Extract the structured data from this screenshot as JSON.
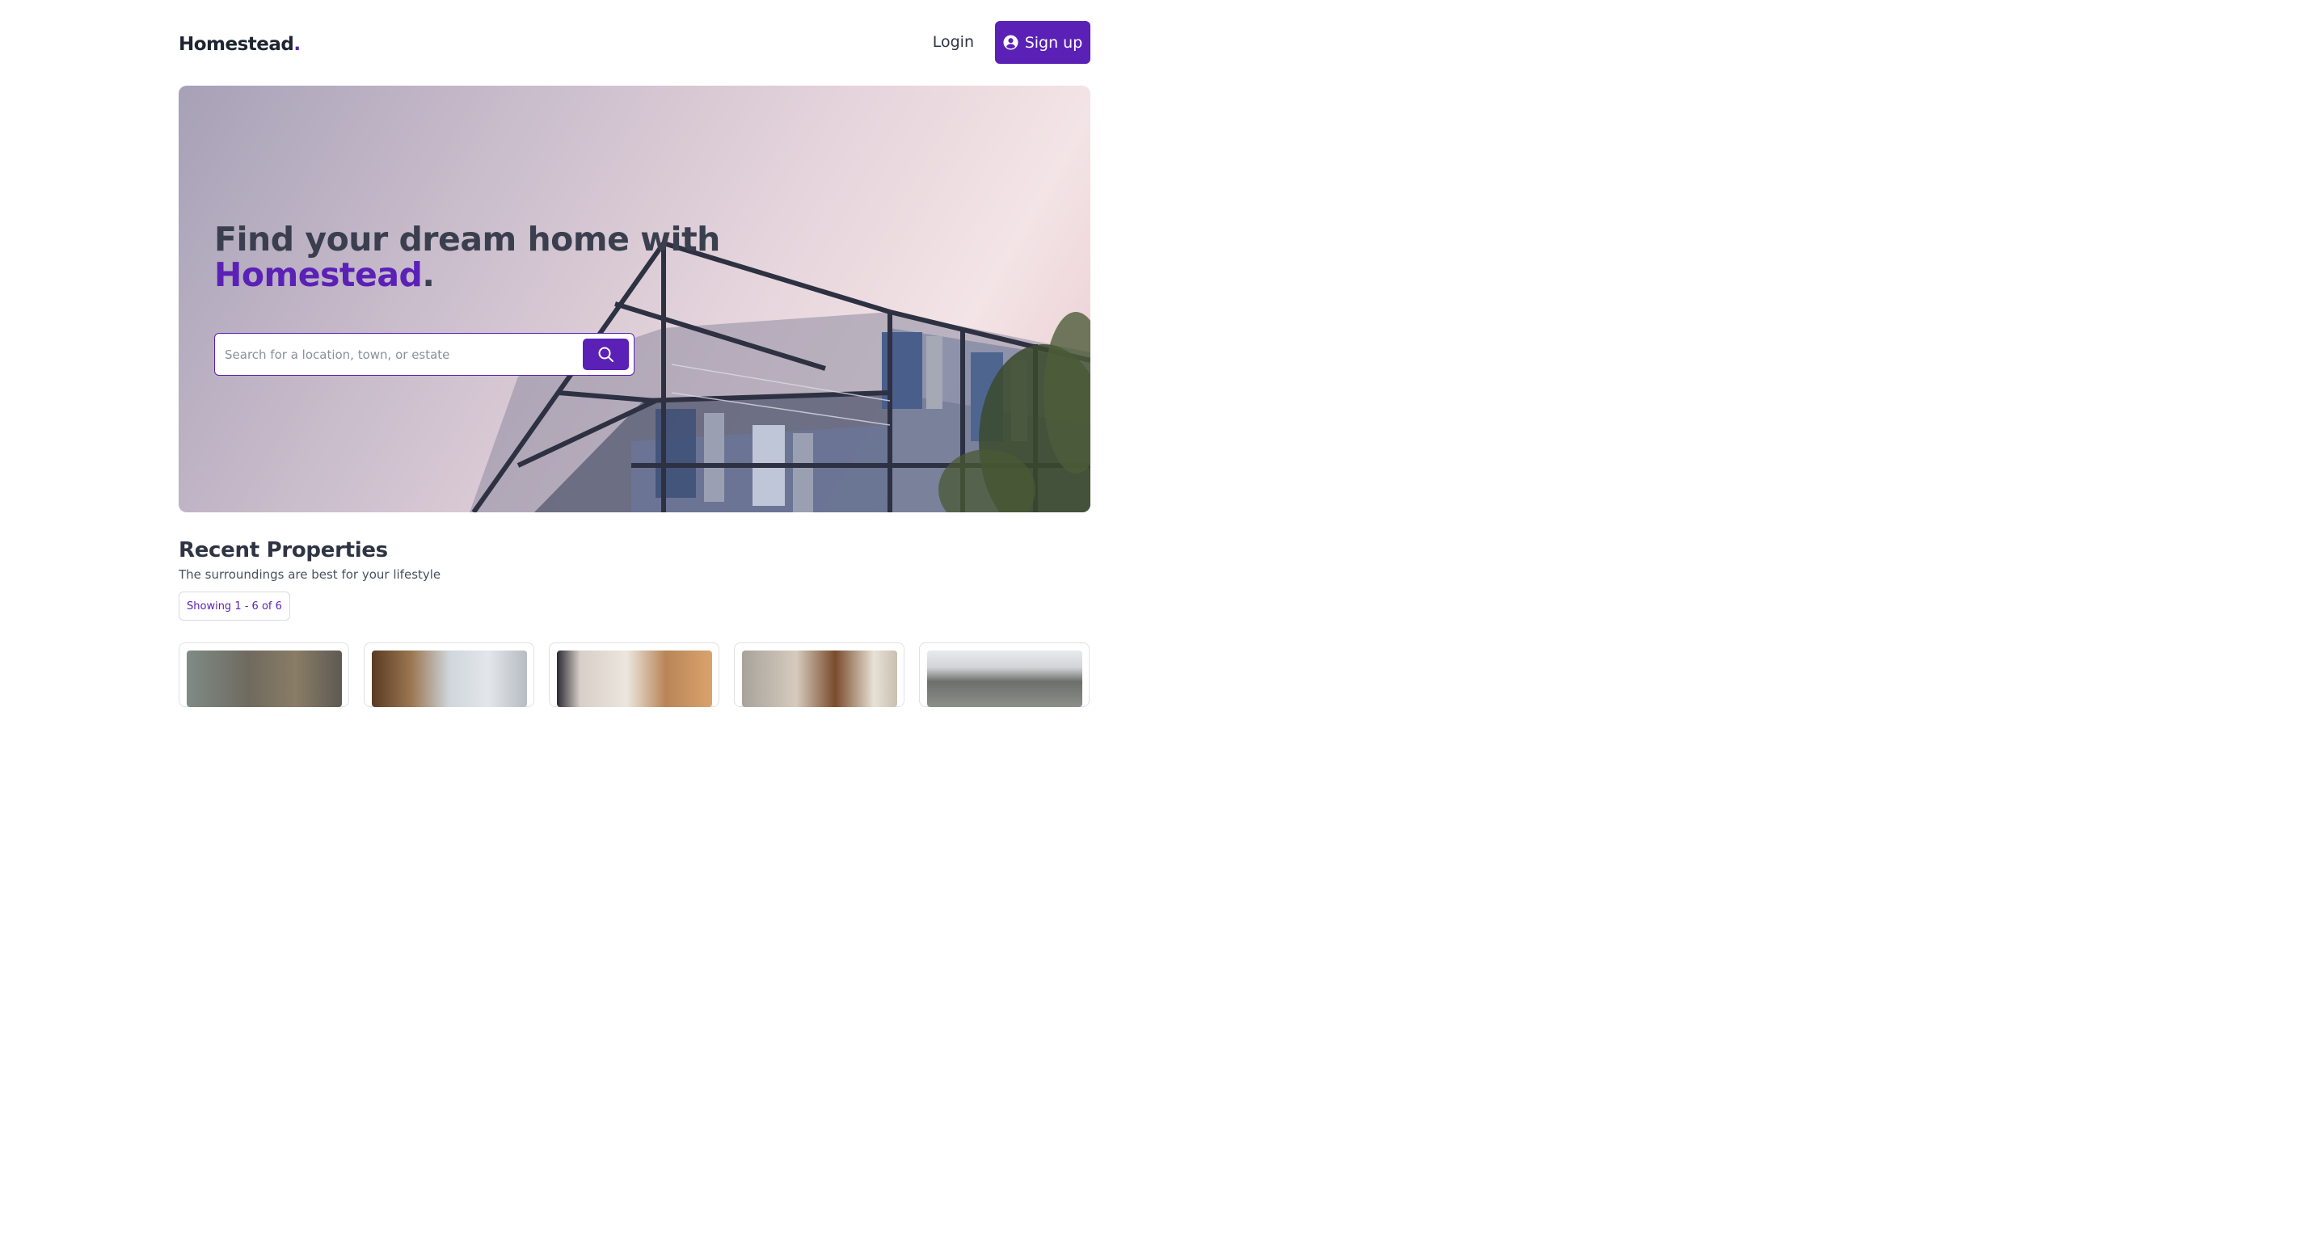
{
  "header": {
    "logo_text": "Homestead",
    "logo_dot": ".",
    "login_label": "Login",
    "signup_label": "Sign up"
  },
  "hero": {
    "title_line1": "Find your dream home with",
    "title_brand": "Homestead",
    "title_dot": ".",
    "search_placeholder": "Search for a location, town, or estate"
  },
  "recent": {
    "title": "Recent Properties",
    "subtitle": "The surroundings are best for your lifestyle",
    "count_label": "Showing 1 - 6 of 6"
  },
  "colors": {
    "accent": "#5b21b6",
    "text": "#2f3445"
  },
  "icons": {
    "signup": "user-circle-icon",
    "search": "search-icon"
  }
}
